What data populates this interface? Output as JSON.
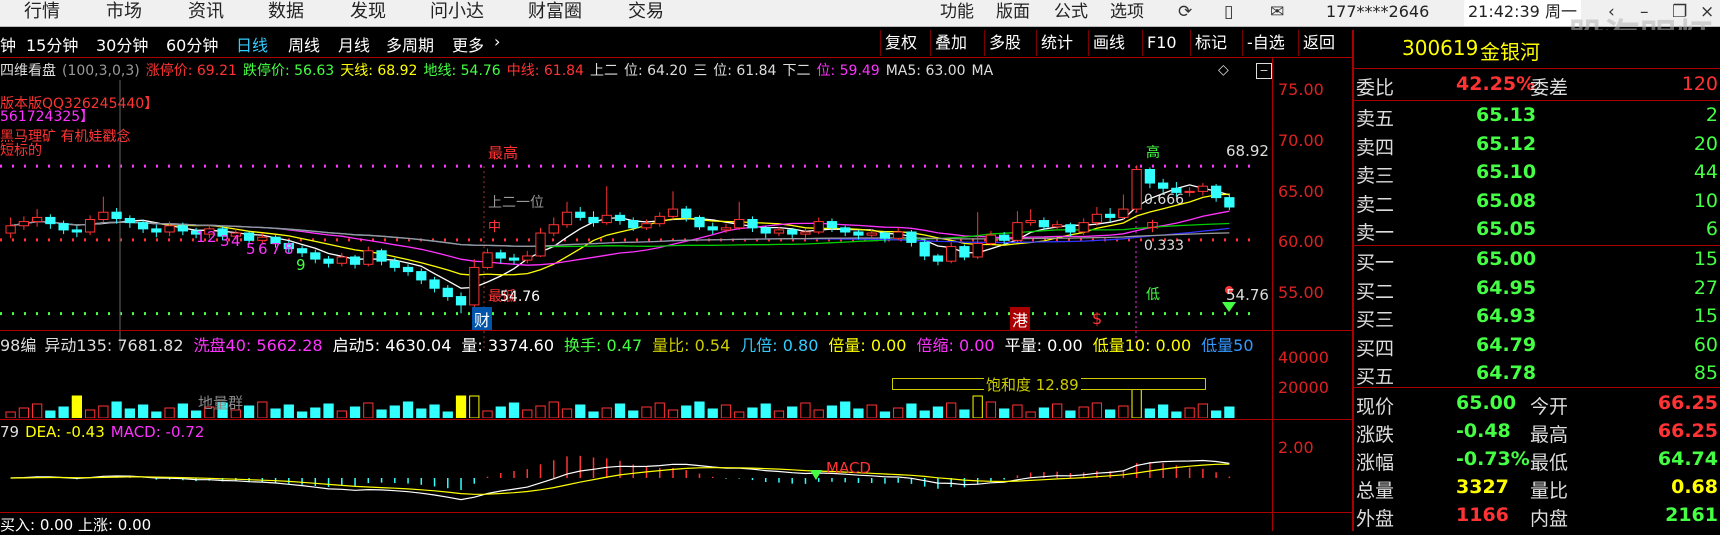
{
  "topmenu": [
    "行情",
    "市场",
    "资讯",
    "数据",
    "发现",
    "问小达",
    "财富圈",
    "交易"
  ],
  "topright": {
    "func": "功能",
    "layout": "版面",
    "formula": "公式",
    "options": "选项",
    "account": "177****2646",
    "clock": "21:42:39 周一"
  },
  "watermark": "股海明灯",
  "periods": [
    "钟",
    "15分钟",
    "30分钟",
    "60分钟",
    "日线",
    "周线",
    "月线",
    "多周期",
    "更多"
  ],
  "active_period": "日线",
  "tools": [
    "复权",
    "叠加",
    "多股",
    "统计",
    "画线",
    "F10",
    "标记",
    "-自选",
    "返回"
  ],
  "indicator_line": [
    {
      "t": "四维看盘",
      "c": "#ddd"
    },
    {
      "t": "(100,3,0,3)",
      "c": "#999"
    },
    {
      "t": "涨停价: 69.21",
      "c": "#f33"
    },
    {
      "t": "跌停价: 56.63",
      "c": "#4f4"
    },
    {
      "t": "天线: 68.92",
      "c": "#ff0"
    },
    {
      "t": "地线: 54.76",
      "c": "#4f4"
    },
    {
      "t": "中线: 61.84",
      "c": "#f33"
    },
    {
      "t": "上二",
      "c": "#ddd"
    },
    {
      "t": "位: 64.20",
      "c": "#ddd"
    },
    {
      "t": "三",
      "c": "#ddd"
    },
    {
      "t": "位: 61.84",
      "c": "#ddd"
    },
    {
      "t": "下二",
      "c": "#ddd"
    },
    {
      "t": "位: 59.49",
      "c": "#f3f"
    },
    {
      "t": "MA5: 63.00",
      "c": "#ddd"
    },
    {
      "t": "MA",
      "c": "#ddd"
    }
  ],
  "annotations": {
    "version": "版本版QQ326245440】",
    "code": "561724325】",
    "mine": "黑马理矿 有机娃戳念",
    "label": "短标的",
    "high": "最高",
    "low": "最低",
    "low_val": "54.76",
    "cai": "财",
    "gang": "港",
    "dollar": "$",
    "gao": "高",
    "di": "低",
    "v0666": "0.666",
    "v0333": "0.333",
    "hi_val": "68.92",
    "lo_val": "54.76",
    "zhong": "中",
    "upper": "上二一位",
    "nums": [
      "1",
      "2",
      "3",
      "4",
      "5",
      "6",
      "7",
      "8",
      "9"
    ]
  },
  "price_axis": [
    "75.00",
    "70.00",
    "65.00",
    "60.00",
    "55.00"
  ],
  "vol_stats": [
    {
      "t": "98编_异动135: 7681.82",
      "c": "#ddd"
    },
    {
      "t": "洗盘40: 5662.28",
      "c": "#f3f"
    },
    {
      "t": "启动5: 4630.04",
      "c": "#fff"
    },
    {
      "t": "量: 3374.60",
      "c": "#fff"
    },
    {
      "t": "换手: 0.47",
      "c": "#4f4"
    },
    {
      "t": "量比: 0.54",
      "c": "#cc0"
    },
    {
      "t": "几倍: 0.80",
      "c": "#3cf"
    },
    {
      "t": "倍量: 0.00",
      "c": "#ff0"
    },
    {
      "t": "倍缩: 0.00",
      "c": "#f3f"
    },
    {
      "t": "平量: 0.00",
      "c": "#fff"
    },
    {
      "t": "低量10: 0.00",
      "c": "#ff0"
    },
    {
      "t": "低量50",
      "c": "#39f"
    }
  ],
  "vol_axis": [
    "40000",
    "20000"
  ],
  "saturation": "饱和度 12.89",
  "dilang": "地量群",
  "macd_line": [
    {
      "t": "79",
      "c": "#ddd"
    },
    {
      "t": "DEA: -0.43",
      "c": "#ff0"
    },
    {
      "t": "MACD: -0.72",
      "c": "#f3f"
    }
  ],
  "macd_axis": [
    "2.00"
  ],
  "macd_label": "MACD",
  "bottom_line": "买入: 0.00 上涨: 0.00",
  "stock": {
    "code": "300619",
    "name": "金银河"
  },
  "ratio": {
    "label1": "委比",
    "val1": "42.25%",
    "label2": "委差",
    "val2": "120"
  },
  "asks": [
    {
      "label": "卖五",
      "price": "65.13",
      "vol": "2"
    },
    {
      "label": "卖四",
      "price": "65.12",
      "vol": "20"
    },
    {
      "label": "卖三",
      "price": "65.10",
      "vol": "44"
    },
    {
      "label": "卖二",
      "price": "65.08",
      "vol": "10"
    },
    {
      "label": "卖一",
      "price": "65.05",
      "vol": "6"
    }
  ],
  "bids": [
    {
      "label": "买一",
      "price": "65.00",
      "vol": "15"
    },
    {
      "label": "买二",
      "price": "64.95",
      "vol": "27"
    },
    {
      "label": "买三",
      "price": "64.93",
      "vol": "15"
    },
    {
      "label": "买四",
      "price": "64.79",
      "vol": "60"
    },
    {
      "label": "买五",
      "price": "64.78",
      "vol": "85"
    }
  ],
  "quote": [
    {
      "l1": "现价",
      "v1": "65.00",
      "l2": "今开",
      "v2": "66.25",
      "c1": "#4f4",
      "c2": "#f33"
    },
    {
      "l1": "涨跌",
      "v1": "-0.48",
      "l2": "最高",
      "v2": "66.25",
      "c1": "#4f4",
      "c2": "#f33"
    },
    {
      "l1": "涨幅",
      "v1": "-0.73%",
      "l2": "最低",
      "v2": "64.74",
      "c1": "#4f4",
      "c2": "#4f4"
    },
    {
      "l1": "总量",
      "v1": "3327",
      "l2": "量比",
      "v2": "0.68",
      "c1": "#ff0",
      "c2": "#ff0"
    },
    {
      "l1": "外盘",
      "v1": "1166",
      "l2": "内盘",
      "v2": "2161",
      "c1": "#f33",
      "c2": "#4f4"
    }
  ],
  "chart_data": {
    "type": "candlestick",
    "ylim": [
      53,
      77
    ],
    "candles": [
      [
        62.5,
        63.2,
        64.0,
        62.0
      ],
      [
        63.2,
        63.6,
        64.1,
        62.8
      ],
      [
        63.6,
        64.0,
        64.8,
        63.1
      ],
      [
        64.0,
        63.4,
        64.3,
        62.9
      ],
      [
        63.4,
        62.8,
        63.7,
        62.4
      ],
      [
        62.8,
        62.6,
        63.2,
        62.1
      ],
      [
        62.6,
        63.8,
        64.2,
        62.3
      ],
      [
        63.8,
        64.5,
        66.0,
        63.5
      ],
      [
        64.5,
        63.9,
        64.9,
        63.4
      ],
      [
        63.9,
        63.5,
        64.2,
        63.0
      ],
      [
        63.5,
        62.9,
        63.8,
        62.5
      ],
      [
        62.9,
        62.6,
        63.3,
        62.1
      ],
      [
        62.6,
        63.2,
        63.6,
        62.2
      ],
      [
        63.2,
        62.7,
        63.5,
        62.3
      ],
      [
        62.7,
        62.4,
        63.0,
        62.0
      ],
      [
        62.4,
        62.9,
        63.3,
        62.0
      ],
      [
        62.9,
        62.2,
        63.1,
        61.8
      ],
      [
        62.2,
        62.5,
        62.9,
        61.9
      ],
      [
        62.5,
        61.8,
        62.7,
        61.4
      ],
      [
        61.8,
        62.1,
        62.5,
        61.5
      ],
      [
        62.1,
        61.5,
        62.3,
        61.1
      ],
      [
        61.5,
        61.0,
        61.8,
        60.6
      ],
      [
        61.0,
        60.6,
        61.3,
        60.2
      ],
      [
        60.6,
        60.0,
        60.9,
        59.6
      ],
      [
        60.0,
        59.6,
        60.3,
        59.2
      ],
      [
        59.6,
        60.2,
        60.6,
        59.3
      ],
      [
        60.2,
        59.5,
        60.4,
        59.1
      ],
      [
        59.5,
        60.8,
        61.2,
        59.3
      ],
      [
        60.8,
        59.8,
        61.0,
        59.4
      ],
      [
        59.8,
        59.2,
        60.1,
        58.8
      ],
      [
        59.2,
        58.8,
        59.5,
        58.4
      ],
      [
        58.8,
        58.0,
        59.1,
        57.6
      ],
      [
        58.0,
        57.2,
        58.3,
        56.8
      ],
      [
        57.2,
        56.4,
        57.5,
        56.0
      ],
      [
        56.4,
        55.6,
        56.8,
        54.8
      ],
      [
        55.6,
        59.2,
        60.0,
        55.4
      ],
      [
        59.2,
        60.6,
        61.0,
        59.0
      ],
      [
        60.6,
        60.1,
        60.9,
        59.6
      ],
      [
        60.1,
        59.9,
        60.5,
        59.5
      ],
      [
        59.9,
        60.3,
        60.8,
        59.6
      ],
      [
        60.3,
        62.5,
        63.0,
        60.2
      ],
      [
        62.5,
        63.3,
        64.0,
        62.2
      ],
      [
        63.3,
        64.5,
        65.5,
        63.0
      ],
      [
        64.5,
        64.0,
        65.0,
        63.7
      ],
      [
        64.0,
        63.5,
        64.6,
        63.1
      ],
      [
        63.5,
        64.2,
        67.0,
        63.3
      ],
      [
        64.2,
        63.7,
        64.5,
        63.3
      ],
      [
        63.7,
        63.0,
        64.0,
        62.7
      ],
      [
        63.0,
        63.4,
        63.8,
        62.8
      ],
      [
        63.4,
        64.1,
        64.5,
        63.1
      ],
      [
        64.1,
        64.8,
        66.5,
        63.8
      ],
      [
        64.8,
        64.0,
        65.1,
        63.6
      ],
      [
        64.0,
        63.1,
        64.2,
        62.8
      ],
      [
        63.1,
        62.8,
        63.5,
        62.4
      ],
      [
        62.8,
        63.0,
        63.4,
        62.5
      ],
      [
        63.0,
        63.8,
        65.5,
        62.8
      ],
      [
        63.8,
        63.0,
        64.1,
        62.6
      ],
      [
        63.0,
        62.5,
        63.2,
        62.0
      ],
      [
        62.5,
        62.8,
        63.1,
        62.2
      ],
      [
        62.8,
        62.4,
        63.0,
        62.0
      ],
      [
        62.4,
        62.6,
        62.9,
        62.0
      ],
      [
        62.6,
        63.6,
        64.0,
        62.4
      ],
      [
        63.6,
        63.0,
        63.9,
        62.6
      ],
      [
        63.0,
        62.6,
        63.2,
        62.2
      ],
      [
        62.6,
        62.3,
        62.8,
        61.9
      ],
      [
        62.3,
        62.5,
        62.9,
        61.9
      ],
      [
        62.5,
        62.0,
        62.7,
        61.6
      ],
      [
        62.0,
        62.6,
        63.0,
        61.8
      ],
      [
        62.6,
        61.6,
        62.8,
        61.2
      ],
      [
        61.6,
        60.3,
        61.8,
        59.9
      ],
      [
        60.3,
        59.8,
        60.5,
        59.4
      ],
      [
        59.8,
        61.2,
        61.6,
        59.6
      ],
      [
        61.2,
        60.2,
        61.4,
        59.9
      ],
      [
        60.2,
        61.5,
        64.5,
        60.0
      ],
      [
        61.5,
        62.3,
        62.7,
        61.3
      ],
      [
        62.3,
        61.8,
        62.6,
        61.4
      ],
      [
        61.8,
        63.5,
        64.6,
        61.6
      ],
      [
        63.5,
        63.7,
        64.8,
        63.2
      ],
      [
        63.7,
        63.1,
        64.0,
        62.8
      ],
      [
        63.1,
        63.3,
        63.7,
        62.9
      ],
      [
        63.3,
        62.6,
        63.5,
        62.2
      ],
      [
        62.6,
        63.5,
        63.9,
        62.3
      ],
      [
        63.5,
        64.3,
        65.0,
        63.2
      ],
      [
        64.3,
        64.0,
        64.9,
        63.6
      ],
      [
        64.0,
        64.8,
        66.2,
        63.8
      ],
      [
        64.8,
        68.6,
        69.0,
        64.5
      ],
      [
        68.6,
        67.3,
        68.8,
        66.8
      ],
      [
        67.3,
        66.8,
        67.7,
        66.3
      ],
      [
        66.8,
        66.4,
        67.4,
        66.0
      ],
      [
        66.4,
        66.5,
        66.9,
        66.0
      ],
      [
        66.5,
        67.0,
        67.3,
        66.1
      ],
      [
        67.0,
        65.9,
        67.2,
        65.5
      ],
      [
        65.9,
        65.0,
        66.3,
        64.7
      ]
    ]
  }
}
